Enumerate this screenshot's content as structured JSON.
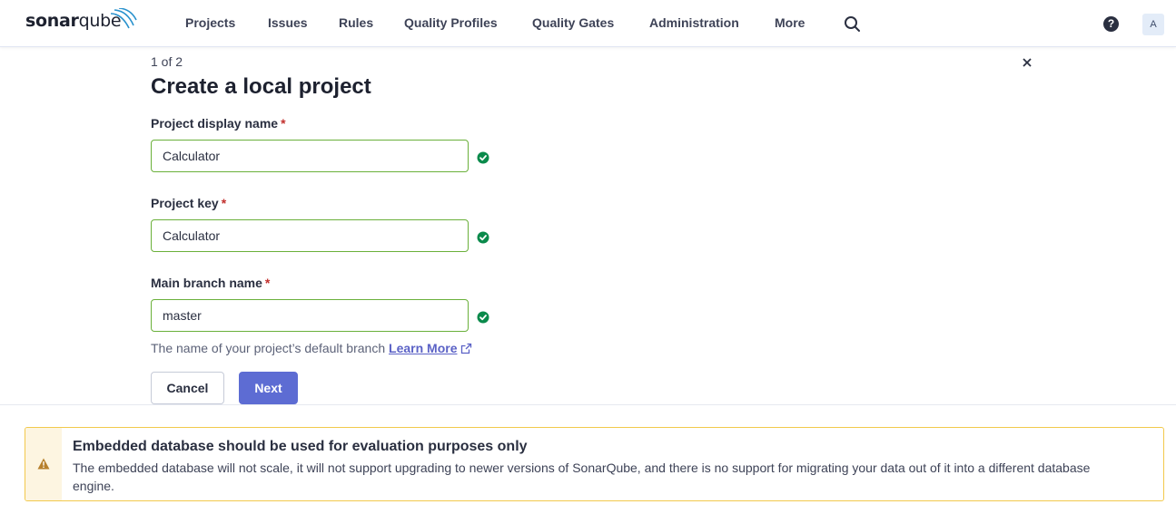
{
  "brand": {
    "name_bold": "sonar",
    "name_light": "qube"
  },
  "nav": {
    "items": [
      "Projects",
      "Issues",
      "Rules",
      "Quality Profiles",
      "Quality Gates",
      "Administration",
      "More"
    ],
    "avatar": "A",
    "help": "?"
  },
  "form": {
    "step": "1 of 2",
    "title": "Create a local project",
    "fields": [
      {
        "label": "Project display name",
        "required": "*",
        "value": "Calculator"
      },
      {
        "label": "Project key",
        "required": "*",
        "value": "Calculator"
      },
      {
        "label": "Main branch name",
        "required": "*",
        "value": "master"
      }
    ],
    "help_text": "The name of your project’s default branch",
    "help_link": "Learn More",
    "cancel_label": "Cancel",
    "next_label": "Next"
  },
  "warning": {
    "title": "Embedded database should be used for evaluation purposes only",
    "body": "The embedded database will not scale, it will not support upgrading to newer versions of SonarQube, and there is no support for migrating your data out of it into a different database engine."
  },
  "colors": {
    "accent": "#5d6cd3",
    "valid": "#0a8a4b",
    "input_border_valid": "#6ab03a",
    "warning_border": "#f2c94c",
    "warning_icon": "#b7802c",
    "required": "#c2302d"
  }
}
